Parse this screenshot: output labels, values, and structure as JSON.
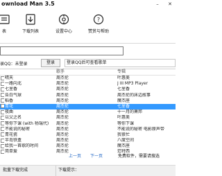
{
  "window": {
    "title": "ownload Man 3.5",
    "minimize": "–",
    "close": "✕"
  },
  "toolbar": [
    {
      "label": "表",
      "icon": "playlist-icon"
    },
    {
      "label": "下载列表",
      "icon": "download-list-icon"
    },
    {
      "label": "设置中心",
      "icon": "settings-icon"
    },
    {
      "label": "赞赏与帮助",
      "icon": "help-icon"
    }
  ],
  "search": {
    "value": ""
  },
  "status": {
    "user_text": "录QQ：未登录",
    "login_label": "登录",
    "hint": "登录QQ后可查看歌单"
  },
  "table": {
    "headers": {
      "artist": "歌手",
      "album": "专辑"
    },
    "rows": [
      {
        "title": "晴天",
        "artist": "周杰伦",
        "album": "叶惠美"
      },
      {
        "title": "一路向北",
        "artist": "周杰伦",
        "album": "J III MP3 Player"
      },
      {
        "title": "七里香",
        "artist": "周杰伦",
        "album": "七里香"
      },
      {
        "title": "告白气球",
        "artist": "周杰伦",
        "album": "周杰伦的床边故事"
      },
      {
        "title": "稻香",
        "artist": "周杰伦",
        "album": "魔杰座"
      },
      {
        "title": "青花",
        "artist": "周杰伦",
        "album": "七里香",
        "selected": true
      },
      {
        "title": "夜曲",
        "artist": "周杰伦",
        "album": "十一月的萧邦"
      },
      {
        "title": "以父之名",
        "artist": "周杰伦",
        "album": "叶惠美"
      },
      {
        "title": "等你下课 (with 杨瑞代)",
        "artist": "周杰伦",
        "album": "等你下课"
      },
      {
        "title": "不能说的秘密",
        "artist": "周杰伦",
        "album": "不能说的秘密 电影原声带"
      },
      {
        "title": "青花瓷",
        "artist": "周杰伦",
        "album": "我很忙"
      },
      {
        "title": "半岛铁盒",
        "artist": "周杰伦",
        "album": "八度空间"
      },
      {
        "title": "给我一首歌的时间",
        "artist": "周杰伦",
        "album": "魔杰座"
      },
      {
        "title": "简单爱",
        "artist": "周杰伦",
        "album": "范特西"
      }
    ]
  },
  "pager": {
    "prev": "上一页",
    "next": "下一页",
    "hint": "免费软件，需要请搜选"
  },
  "footer": {
    "left": "批量下载完成",
    "right": "下载提示："
  },
  "colors": {
    "selected_row": "#3399ff",
    "link": "#1a62c4"
  }
}
